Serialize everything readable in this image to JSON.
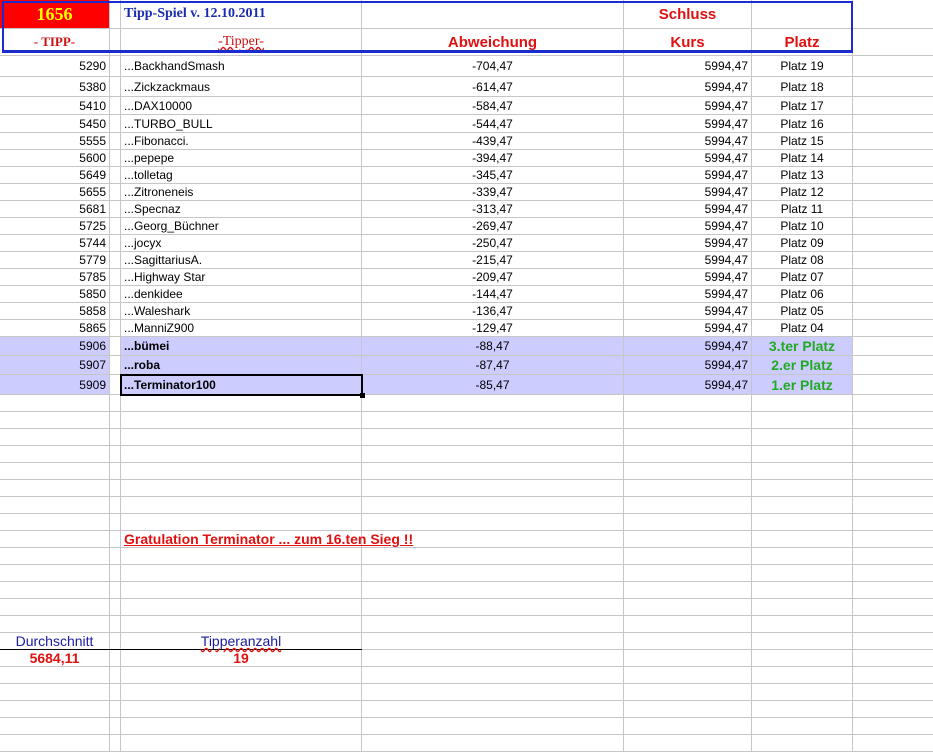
{
  "header": {
    "number": "1656",
    "title": "Tipp-Spiel v. 12.10.2011",
    "schluss": "Schluss",
    "col_tipp": "- TIPP-",
    "col_tipper": "-Tipper-",
    "col_abweichung": "Abweichung",
    "col_kurs": "Kurs",
    "col_platz": "Platz"
  },
  "rows": [
    {
      "tipp": "5290",
      "tipper": "...BackhandSmash",
      "abw": "-704,47",
      "kurs": "5994,47",
      "platz": "Platz 19"
    },
    {
      "tipp": "5380",
      "tipper": "...Zickzackmaus",
      "abw": "-614,47",
      "kurs": "5994,47",
      "platz": "Platz 18"
    },
    {
      "tipp": "5410",
      "tipper": "...DAX10000",
      "abw": "-584,47",
      "kurs": "5994,47",
      "platz": "Platz 17"
    },
    {
      "tipp": "5450",
      "tipper": "...TURBO_BULL",
      "abw": "-544,47",
      "kurs": "5994,47",
      "platz": "Platz 16"
    },
    {
      "tipp": "5555",
      "tipper": "...Fibonacci.",
      "abw": "-439,47",
      "kurs": "5994,47",
      "platz": "Platz 15"
    },
    {
      "tipp": "5600",
      "tipper": "...pepepe",
      "abw": "-394,47",
      "kurs": "5994,47",
      "platz": "Platz 14"
    },
    {
      "tipp": "5649",
      "tipper": "...tolletag",
      "abw": "-345,47",
      "kurs": "5994,47",
      "platz": "Platz 13"
    },
    {
      "tipp": "5655",
      "tipper": "...Zitroneneis",
      "abw": "-339,47",
      "kurs": "5994,47",
      "platz": "Platz 12"
    },
    {
      "tipp": "5681",
      "tipper": "...Specnaz",
      "abw": "-313,47",
      "kurs": "5994,47",
      "platz": "Platz 11"
    },
    {
      "tipp": "5725",
      "tipper": "...Georg_Büchner",
      "abw": "-269,47",
      "kurs": "5994,47",
      "platz": "Platz 10"
    },
    {
      "tipp": "5744",
      "tipper": "...jocyx",
      "abw": "-250,47",
      "kurs": "5994,47",
      "platz": "Platz 09"
    },
    {
      "tipp": "5779",
      "tipper": "...SagittariusA.",
      "abw": "-215,47",
      "kurs": "5994,47",
      "platz": "Platz 08"
    },
    {
      "tipp": "5785",
      "tipper": "...Highway Star",
      "abw": "-209,47",
      "kurs": "5994,47",
      "platz": "Platz 07"
    },
    {
      "tipp": "5850",
      "tipper": "...denkidee",
      "abw": "-144,47",
      "kurs": "5994,47",
      "platz": "Platz 06"
    },
    {
      "tipp": "5858",
      "tipper": "...Waleshark",
      "abw": "-136,47",
      "kurs": "5994,47",
      "platz": "Platz 05"
    },
    {
      "tipp": "5865",
      "tipper": "...ManniZ900",
      "abw": "-129,47",
      "kurs": "5994,47",
      "platz": "Platz 04"
    },
    {
      "tipp": "5906",
      "tipper": "...bümei",
      "abw": "-88,47",
      "kurs": "5994,47",
      "platz": "3.ter Platz",
      "top": true
    },
    {
      "tipp": "5907",
      "tipper": "...roba",
      "abw": "-87,47",
      "kurs": "5994,47",
      "platz": "2.er Platz",
      "top": true
    },
    {
      "tipp": "5909",
      "tipper": "...Terminator100",
      "abw": "-85,47",
      "kurs": "5994,47",
      "platz": "1.er Platz",
      "top": true
    }
  ],
  "gratulation": "Gratulation   Terminator ... zum  16.ten Sieg !!",
  "summary": {
    "durchschnitt_label": "Durchschnitt",
    "durchschnitt_value": "5684,11",
    "tipperanzahl_label": "Tipperanzahl",
    "tipperanzahl_value": "19"
  },
  "colors": {
    "header_red": "#ff0000",
    "number_yellow": "#ffff00",
    "border_blue": "#1a2bd0",
    "highlight": "#ccccff",
    "green": "#22aa22"
  }
}
